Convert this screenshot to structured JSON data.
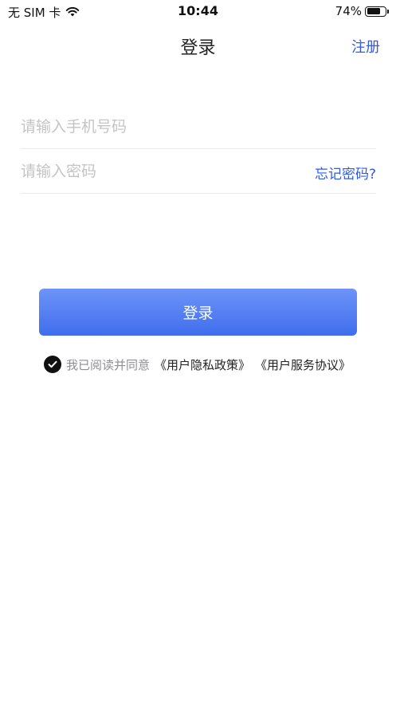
{
  "status_bar": {
    "carrier": "无 SIM 卡",
    "time": "10:44",
    "battery_percent_label": "74%",
    "battery_level": 0.74
  },
  "nav": {
    "title": "登录",
    "register_label": "注册"
  },
  "form": {
    "phone_placeholder": "请输入手机号码",
    "phone_value": "",
    "password_placeholder": "请输入密码",
    "password_value": "",
    "forgot_label": "忘记密码?"
  },
  "login_button_label": "登录",
  "agreement": {
    "checked": true,
    "prefix": "我已阅读并同意",
    "privacy_link": "《用户隐私政策》",
    "service_link": "《用户服务协议》"
  },
  "colors": {
    "link": "#2f5bea",
    "button_gradient_top": "#6e94f8",
    "button_gradient_bottom": "#3f6ded",
    "placeholder": "#c4c4c6"
  }
}
